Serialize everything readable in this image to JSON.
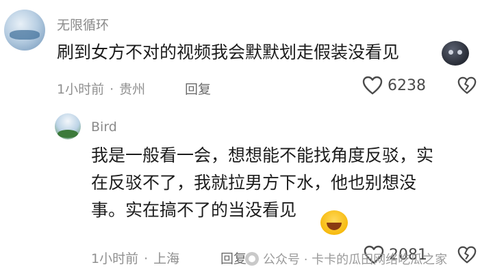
{
  "comment": {
    "username": "无限循环",
    "text": "刷到女方不对的视频我会默默划走假装没看见",
    "time": "1小时前",
    "separator": "·",
    "location": "贵州",
    "reply_label": "回复",
    "likes": "6238",
    "emoji": "dark-face-emoji"
  },
  "reply": {
    "username": "Bird",
    "text_line1": "我是一般看一会，想想能不能找角度反驳，实",
    "text_line2": "在反驳不了，我就拉男方下水，他也别想没",
    "text_line3": "事。实在搞不了的当没看见",
    "time": "1小时前",
    "separator": "·",
    "location": "上海",
    "reply_label": "回复",
    "likes": "2081",
    "emoji": "laughing-tears-emoji"
  },
  "watermark": {
    "text": "公众号 · 卡卡的瓜田网络吃瓜之家"
  },
  "colors": {
    "text": "#1c1c1c",
    "meta": "#8f8f8f",
    "username": "#8a8a8a"
  }
}
